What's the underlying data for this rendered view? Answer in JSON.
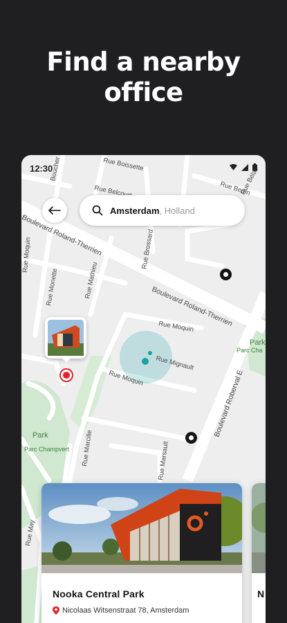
{
  "headline": {
    "line1": "Find a nearby",
    "line2": "office"
  },
  "status_bar": {
    "time": "12:30"
  },
  "search": {
    "city": "Amsterdam",
    "country": ", Holland"
  },
  "map": {
    "streets": {
      "rue_boissette": "Rue Boissette",
      "boucher": "Boucher",
      "rue_bertin": "Rue Bertin",
      "rue_belair": "Rue Bélair",
      "rue_belcourt": "Rue Belcourt",
      "rue_brossard": "Rue Brossard",
      "boulevard_left": "Boulevard Roland-Therrien",
      "boulevard_right": "Boulevard Roland-Therrien",
      "rue_moquin_left": "Rue Moquin",
      "rue_monette": "Rue Monette",
      "rue_mathieu": "Rue Mathieu",
      "rue_moquin_center": "Rue Moquin",
      "rue_mignault": "Rue Mignault",
      "rue_moquin_lower": "Rue Moquin",
      "boulevard_roberval": "Boulevard Roberval E",
      "rue_marcille": "Rue Marcille",
      "rue_marsault": "Rue Marsault",
      "rue_may": "Rue May"
    },
    "parks": {
      "park_left": "Park",
      "park_left_sub": "Parc Champvert",
      "park_right": "Park",
      "park_right_sub": "Parc Cha"
    }
  },
  "cards": [
    {
      "title": "Nooka Central Park",
      "address": "Nicolaas Witsenstraat 78, Amsterdam"
    },
    {
      "title": "N"
    }
  ],
  "colors": {
    "background": "#1f1e21",
    "map_bg": "#eeeeef",
    "park_green": "#cfe8cf",
    "accent_red": "#e5202e",
    "location_teal": "#1aa3a3"
  }
}
